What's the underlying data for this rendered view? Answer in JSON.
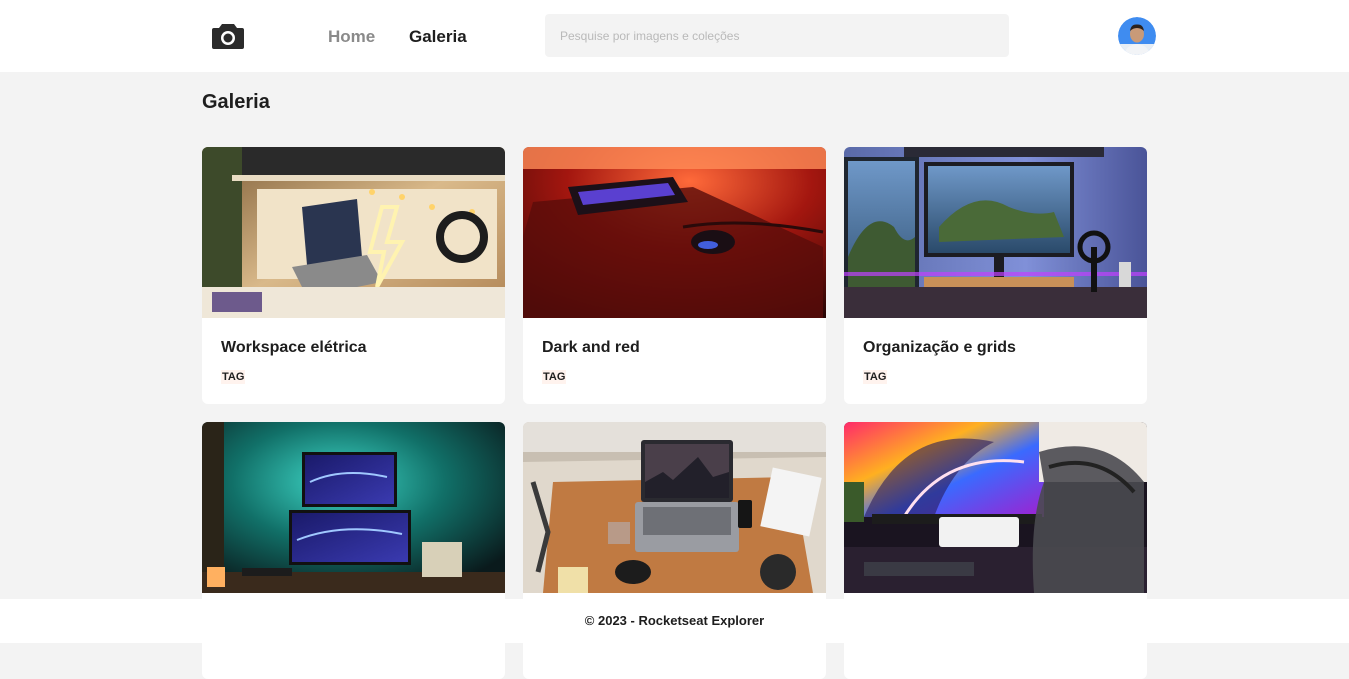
{
  "header": {
    "logo_icon": "camera-icon",
    "nav": [
      {
        "label": "Home",
        "active": false
      },
      {
        "label": "Galeria",
        "active": true
      }
    ],
    "search": {
      "placeholder": "Pesquise por imagens e coleções",
      "value": ""
    },
    "avatar_icon": "user-avatar"
  },
  "main": {
    "title": "Galeria",
    "cards": [
      {
        "title": "Workspace elétrica",
        "tag": "TAG"
      },
      {
        "title": "Dark and red",
        "tag": "TAG"
      },
      {
        "title": "Organização e grids",
        "tag": "TAG"
      },
      {
        "title": "",
        "tag": ""
      },
      {
        "title": "",
        "tag": ""
      },
      {
        "title": "",
        "tag": ""
      }
    ]
  },
  "footer": {
    "text": "© 2023 - Rocketseat Explorer"
  },
  "colors": {
    "background": "#f3f3f3",
    "surface": "#ffffff",
    "text": "#1e1e1e",
    "muted": "#8a8a8a",
    "tag_bg": "#fff3ee"
  }
}
